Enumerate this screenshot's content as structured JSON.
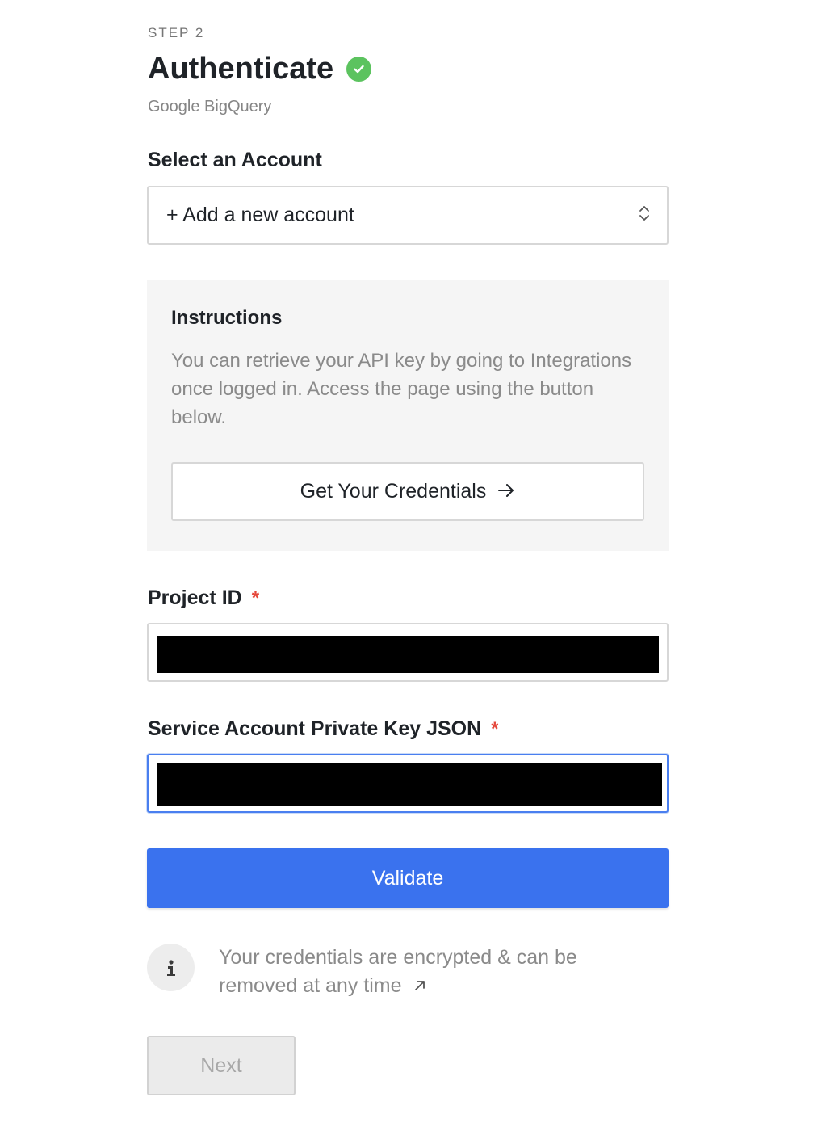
{
  "header": {
    "step": "STEP 2",
    "title": "Authenticate",
    "subtitle": "Google BigQuery"
  },
  "account": {
    "label": "Select an Account",
    "selected": "+ Add a new account"
  },
  "instructions": {
    "title": "Instructions",
    "text": "You can retrieve your API key by going to Integrations once logged in. Access the page using the button below.",
    "button_label": "Get Your Credentials"
  },
  "fields": {
    "project_id": {
      "label": "Project ID",
      "required": "*"
    },
    "service_key": {
      "label": "Service Account Private Key JSON",
      "required": "*"
    }
  },
  "actions": {
    "validate_label": "Validate",
    "next_label": "Next"
  },
  "info": {
    "text": "Your credentials are encrypted & can be removed at any time"
  },
  "colors": {
    "accent": "#3a72ee",
    "success": "#5cc35f",
    "required": "#e5483b"
  },
  "icons": {
    "status": "check-circle-icon",
    "select": "chevron-up-down-icon",
    "credentials": "arrow-right-icon",
    "info": "info-icon",
    "external": "external-link-icon"
  }
}
